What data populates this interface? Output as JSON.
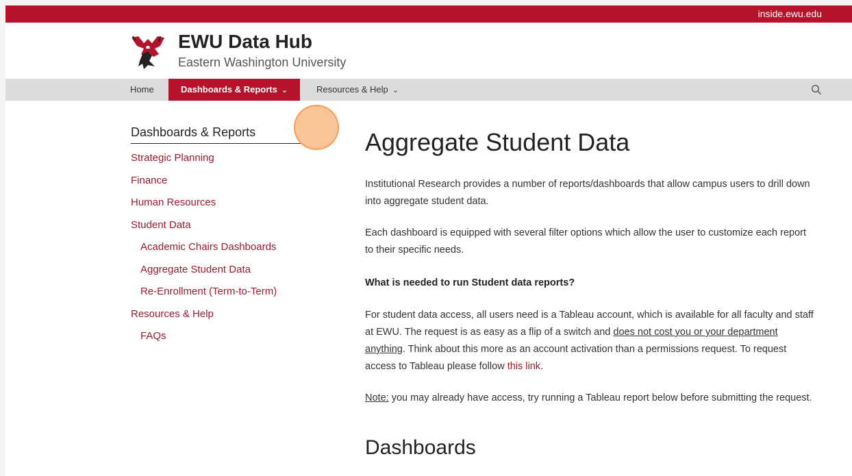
{
  "topbar": {
    "inside_link": "inside.ewu.edu"
  },
  "header": {
    "title": "EWU Data Hub",
    "subtitle": "Eastern Washington University"
  },
  "nav": {
    "home": "Home",
    "dashboards": "Dashboards & Reports",
    "resources": "Resources & Help",
    "chevron": "⌄"
  },
  "sidebar": {
    "title": "Dashboards & Reports",
    "items": [
      "Strategic Planning",
      "Finance",
      "Human Resources",
      "Student Data",
      "Academic Chairs Dashboards",
      "Aggregate Student Data",
      "Re-Enrollment (Term-to-Term)",
      "Resources & Help",
      "FAQs"
    ]
  },
  "main": {
    "title": "Aggregate Student Data",
    "p1": "Institutional Research provides a number of reports/dashboards that allow campus users to drill down into aggregate student data.",
    "p2": "Each dashboard is equipped with several filter options which allow the user to customize each report to their specific needs.",
    "q": "What is needed to run Student data reports?",
    "p3a": "For student data access, all users need is a Tableau account, which is available for all faculty and staff at EWU. The request is as easy as a flip of a switch and ",
    "p3u": "does not cost you or your department anything",
    "p3b": ". Think about this more as an account activation than a permissions request. To request access to Tableau please follow ",
    "p3link": "this link",
    "p3c": ".",
    "note_label": "Note:",
    "note_text": " you may already have access, try running a Tableau report below before submitting the request.",
    "h2": "Dashboards"
  },
  "colors": {
    "brand": "#b5132b",
    "link": "#9c1b2e",
    "nav_bg": "#dcdcdc",
    "cursor": "#f8a562"
  }
}
